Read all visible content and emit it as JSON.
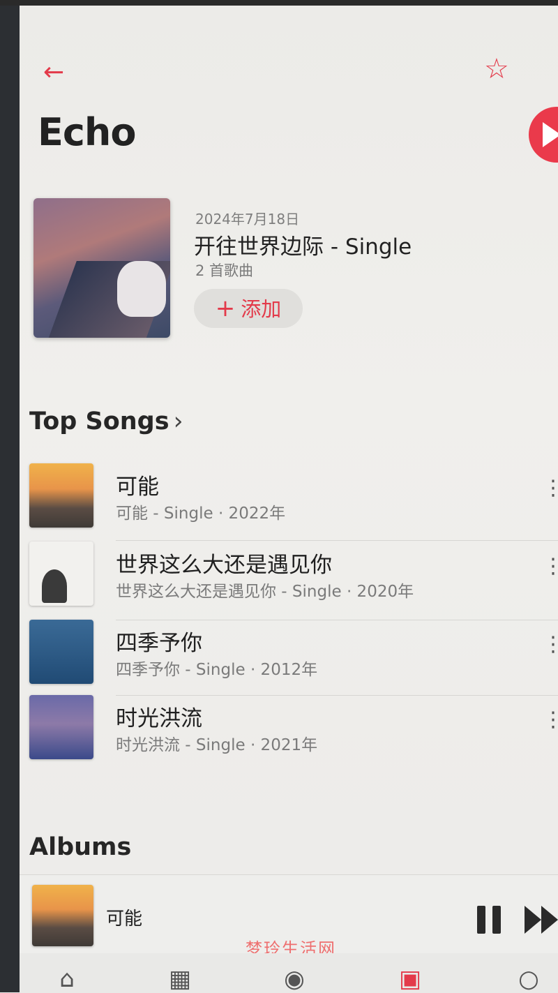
{
  "header": {
    "back_icon": "arrow-left-icon",
    "favorite_icon": "star-icon",
    "title": "Echo"
  },
  "accent_color": "#e33a4a",
  "featured_release": {
    "date": "2024年7月18日",
    "title": "开往世界边际 - Single",
    "track_count": "2 首歌曲",
    "add_label": "添加"
  },
  "top_songs": {
    "heading": "Top Songs",
    "items": [
      {
        "title": "可能",
        "subtitle": "可能 - Single · 2022年"
      },
      {
        "title": "世界这么大还是遇见你",
        "subtitle": "世界这么大还是遇见你 - Single · 2020年"
      },
      {
        "title": "四季予你",
        "subtitle": "四季予你 - Single · 2012年"
      },
      {
        "title": "时光洪流",
        "subtitle": "时光洪流 - Single · 2021年"
      }
    ]
  },
  "albums": {
    "heading": "Albums"
  },
  "now_playing": {
    "title": "可能",
    "state": "playing"
  },
  "watermark": "梦玲生活网",
  "tabbar": {
    "items": [
      "home-icon",
      "browse-grid-icon",
      "radio-icon",
      "library-icon",
      "search-icon"
    ]
  }
}
